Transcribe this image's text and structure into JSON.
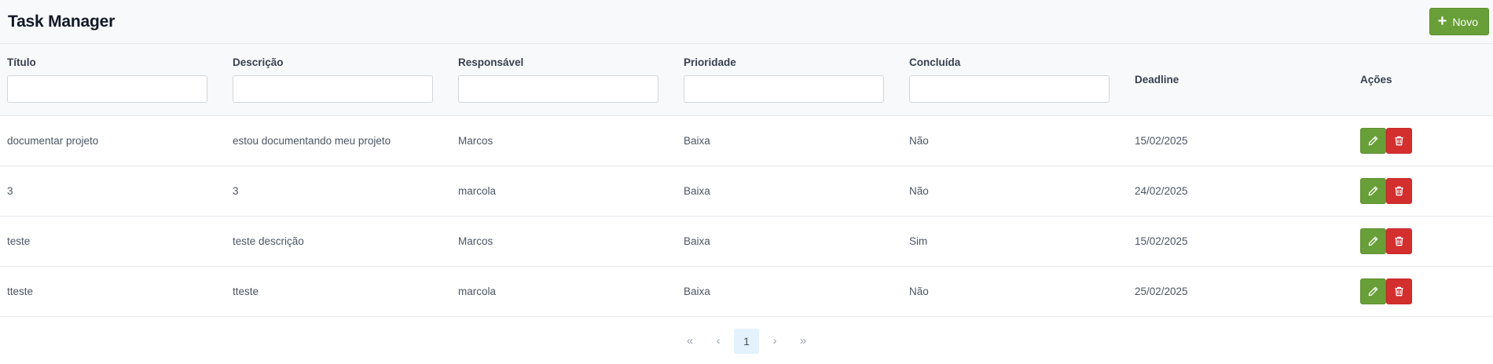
{
  "header": {
    "title": "Task Manager",
    "new_button_label": "Novo"
  },
  "table": {
    "columns": {
      "titulo": "Título",
      "descricao": "Descrição",
      "responsavel": "Responsável",
      "prioridade": "Prioridade",
      "concluida": "Concluída",
      "deadline": "Deadline",
      "acoes": "Ações"
    },
    "filters": {
      "titulo": "",
      "descricao": "",
      "responsavel": "",
      "prioridade": "",
      "concluida": ""
    },
    "rows": [
      {
        "titulo": "documentar projeto",
        "descricao": "estou documentando meu projeto",
        "responsavel": "Marcos",
        "prioridade": "Baixa",
        "concluida": "Não",
        "deadline": "15/02/2025"
      },
      {
        "titulo": "3",
        "descricao": "3",
        "responsavel": "marcola",
        "prioridade": "Baixa",
        "concluida": "Não",
        "deadline": "24/02/2025"
      },
      {
        "titulo": "teste",
        "descricao": "teste descrição",
        "responsavel": "Marcos",
        "prioridade": "Baixa",
        "concluida": "Sim",
        "deadline": "15/02/2025"
      },
      {
        "titulo": "tteste",
        "descricao": "tteste",
        "responsavel": "marcola",
        "prioridade": "Baixa",
        "concluida": "Não",
        "deadline": "25/02/2025"
      }
    ]
  },
  "paginator": {
    "first": "«",
    "prev": "‹",
    "current_page": "1",
    "next": "›",
    "last": "»"
  },
  "colors": {
    "success": "#689f38",
    "danger": "#d32f2f",
    "page_active_bg": "#e3f2fd"
  }
}
